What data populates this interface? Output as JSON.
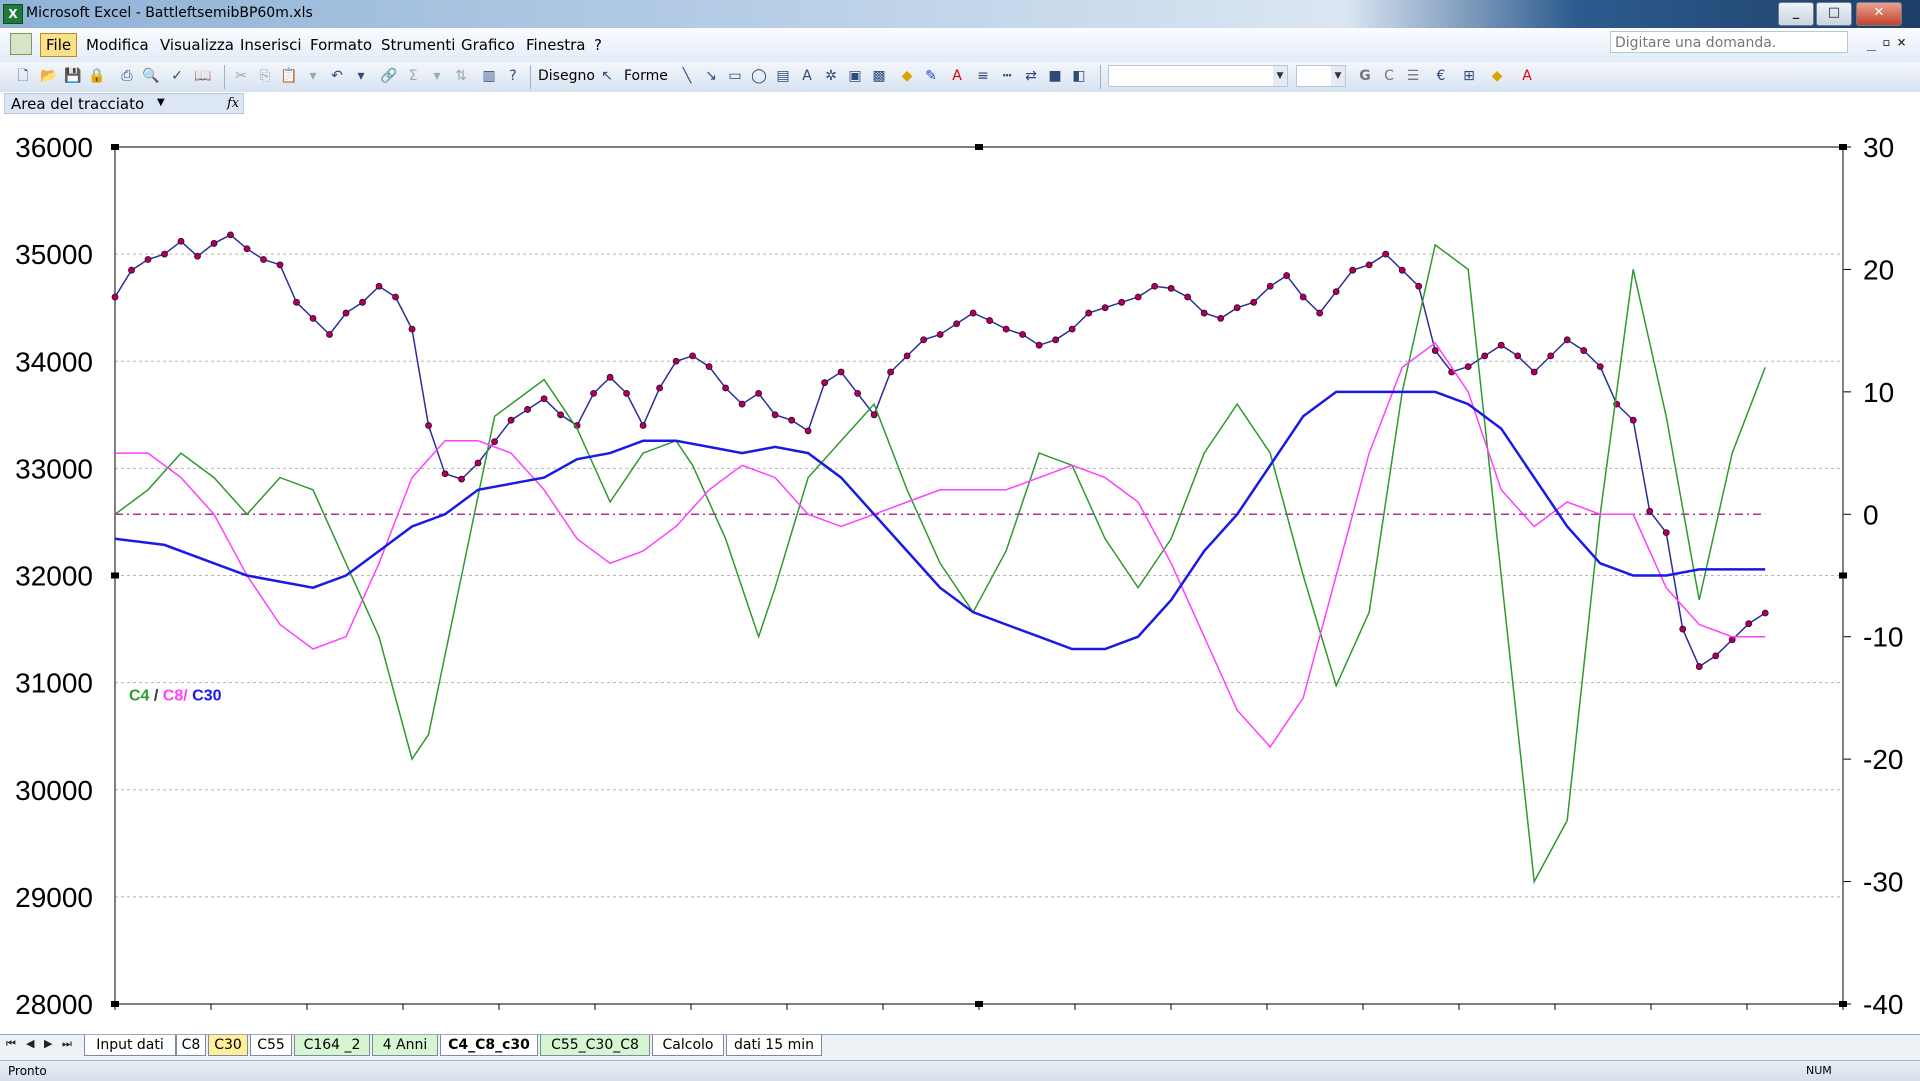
{
  "window": {
    "title": "Microsoft Excel - BattleftsemibBP60m.xls",
    "app_icon": "excel-icon",
    "controls": [
      "_",
      "□",
      "✕"
    ]
  },
  "menu": {
    "items": [
      "File",
      "Modifica",
      "Visualizza",
      "Inserisci",
      "Formato",
      "Strumenti",
      "Grafico",
      "Finestra",
      "?"
    ],
    "help_placeholder": "Digitare una domanda."
  },
  "toolbar": {
    "draw_label": "Disegno",
    "shapes_label": "Forme"
  },
  "namebox": {
    "value": "Area del tracciato",
    "fx": "fx"
  },
  "sheets": {
    "tabs": [
      "Input dati",
      "C8",
      "C30",
      "C55",
      "C164 _2",
      "4 Anni",
      "C4_C8_c30",
      "C55_C30_C8",
      "Calcolo",
      "dati 15 min"
    ],
    "active": "C4_C8_c30"
  },
  "status": {
    "text": "Pronto",
    "num": "NUM"
  },
  "colors": {
    "price": "#2d2d9a",
    "price_marker": "#b0005a",
    "c4": "#2e9a2e",
    "c8": "#ff40ff",
    "c30": "#1a1ae6",
    "zero_line": "#b0308f",
    "grid": "#b5b5b5"
  },
  "chart_data": {
    "type": "line",
    "legend": {
      "c4": "C4",
      "slash1": " / ",
      "c8": "C8/",
      "c30": " C30"
    },
    "y_left": {
      "min": 28000,
      "max": 36000,
      "ticks": [
        "28000",
        "29000",
        "30000",
        "31000",
        "32000",
        "33000",
        "34000",
        "35000",
        "36000"
      ]
    },
    "y_right": {
      "min": -40,
      "max": 30,
      "ticks": [
        "-40",
        "-30",
        "-20",
        "-10",
        "0",
        "10",
        "20",
        "30"
      ]
    },
    "x": {
      "min": 0,
      "max": 100
    },
    "series": [
      {
        "key": "price",
        "axis": "left",
        "markers": true,
        "points": [
          [
            0,
            34600
          ],
          [
            1,
            34850
          ],
          [
            2,
            34950
          ],
          [
            3,
            35000
          ],
          [
            4,
            35120
          ],
          [
            5,
            34980
          ],
          [
            6,
            35100
          ],
          [
            7,
            35180
          ],
          [
            8,
            35050
          ],
          [
            9,
            34950
          ],
          [
            10,
            34900
          ],
          [
            11,
            34550
          ],
          [
            12,
            34400
          ],
          [
            13,
            34250
          ],
          [
            14,
            34450
          ],
          [
            15,
            34550
          ],
          [
            16,
            34700
          ],
          [
            17,
            34600
          ],
          [
            18,
            34300
          ],
          [
            19,
            33400
          ],
          [
            20,
            32950
          ],
          [
            21,
            32900
          ],
          [
            22,
            33050
          ],
          [
            23,
            33250
          ],
          [
            24,
            33450
          ],
          [
            25,
            33550
          ],
          [
            26,
            33650
          ],
          [
            27,
            33500
          ],
          [
            28,
            33400
          ],
          [
            29,
            33700
          ],
          [
            30,
            33850
          ],
          [
            31,
            33700
          ],
          [
            32,
            33400
          ],
          [
            33,
            33750
          ],
          [
            34,
            34000
          ],
          [
            35,
            34050
          ],
          [
            36,
            33950
          ],
          [
            37,
            33750
          ],
          [
            38,
            33600
          ],
          [
            39,
            33700
          ],
          [
            40,
            33500
          ],
          [
            41,
            33450
          ],
          [
            42,
            33350
          ],
          [
            43,
            33800
          ],
          [
            44,
            33900
          ],
          [
            45,
            33700
          ],
          [
            46,
            33500
          ],
          [
            47,
            33900
          ],
          [
            48,
            34050
          ],
          [
            49,
            34200
          ],
          [
            50,
            34250
          ],
          [
            51,
            34350
          ],
          [
            52,
            34450
          ],
          [
            53,
            34380
          ],
          [
            54,
            34300
          ],
          [
            55,
            34250
          ],
          [
            56,
            34150
          ],
          [
            57,
            34200
          ],
          [
            58,
            34300
          ],
          [
            59,
            34450
          ],
          [
            60,
            34500
          ],
          [
            61,
            34550
          ],
          [
            62,
            34600
          ],
          [
            63,
            34700
          ],
          [
            64,
            34680
          ],
          [
            65,
            34600
          ],
          [
            66,
            34450
          ],
          [
            67,
            34400
          ],
          [
            68,
            34500
          ],
          [
            69,
            34550
          ],
          [
            70,
            34700
          ],
          [
            71,
            34800
          ],
          [
            72,
            34600
          ],
          [
            73,
            34450
          ],
          [
            74,
            34650
          ],
          [
            75,
            34850
          ],
          [
            76,
            34900
          ],
          [
            77,
            35000
          ],
          [
            78,
            34850
          ],
          [
            79,
            34700
          ],
          [
            80,
            34100
          ],
          [
            81,
            33900
          ],
          [
            82,
            33950
          ],
          [
            83,
            34050
          ],
          [
            84,
            34150
          ],
          [
            85,
            34050
          ],
          [
            86,
            33900
          ],
          [
            87,
            34050
          ],
          [
            88,
            34200
          ],
          [
            89,
            34100
          ],
          [
            90,
            33950
          ],
          [
            91,
            33600
          ],
          [
            92,
            33450
          ],
          [
            93,
            32600
          ],
          [
            94,
            32400
          ],
          [
            95,
            31500
          ],
          [
            96,
            31150
          ],
          [
            97,
            31250
          ],
          [
            98,
            31400
          ],
          [
            99,
            31550
          ],
          [
            100,
            31650
          ]
        ]
      },
      {
        "key": "c4",
        "axis": "right",
        "markers": false,
        "points": [
          [
            0,
            0
          ],
          [
            2,
            2
          ],
          [
            4,
            5
          ],
          [
            6,
            3
          ],
          [
            8,
            0
          ],
          [
            10,
            3
          ],
          [
            12,
            2
          ],
          [
            14,
            -4
          ],
          [
            16,
            -10
          ],
          [
            18,
            -20
          ],
          [
            19,
            -18
          ],
          [
            21,
            -5
          ],
          [
            23,
            8
          ],
          [
            25,
            10
          ],
          [
            26,
            11
          ],
          [
            28,
            7
          ],
          [
            30,
            1
          ],
          [
            32,
            5
          ],
          [
            34,
            6
          ],
          [
            35,
            4
          ],
          [
            37,
            -2
          ],
          [
            39,
            -10
          ],
          [
            40,
            -6
          ],
          [
            42,
            3
          ],
          [
            44,
            6
          ],
          [
            46,
            9
          ],
          [
            48,
            2
          ],
          [
            50,
            -4
          ],
          [
            52,
            -8
          ],
          [
            54,
            -3
          ],
          [
            56,
            5
          ],
          [
            58,
            4
          ],
          [
            60,
            -2
          ],
          [
            62,
            -6
          ],
          [
            64,
            -2
          ],
          [
            66,
            5
          ],
          [
            68,
            9
          ],
          [
            70,
            5
          ],
          [
            72,
            -5
          ],
          [
            74,
            -14
          ],
          [
            76,
            -8
          ],
          [
            78,
            10
          ],
          [
            80,
            22
          ],
          [
            82,
            20
          ],
          [
            84,
            -5
          ],
          [
            86,
            -30
          ],
          [
            88,
            -25
          ],
          [
            90,
            0
          ],
          [
            92,
            20
          ],
          [
            94,
            8
          ],
          [
            96,
            -7
          ],
          [
            98,
            5
          ],
          [
            100,
            12
          ]
        ]
      },
      {
        "key": "c8",
        "axis": "right",
        "markers": false,
        "points": [
          [
            0,
            5
          ],
          [
            2,
            5
          ],
          [
            4,
            3
          ],
          [
            6,
            0
          ],
          [
            8,
            -5
          ],
          [
            10,
            -9
          ],
          [
            12,
            -11
          ],
          [
            14,
            -10
          ],
          [
            16,
            -4
          ],
          [
            18,
            3
          ],
          [
            20,
            6
          ],
          [
            22,
            6
          ],
          [
            24,
            5
          ],
          [
            26,
            2
          ],
          [
            28,
            -2
          ],
          [
            30,
            -4
          ],
          [
            32,
            -3
          ],
          [
            34,
            -1
          ],
          [
            36,
            2
          ],
          [
            38,
            4
          ],
          [
            40,
            3
          ],
          [
            42,
            0
          ],
          [
            44,
            -1
          ],
          [
            46,
            0
          ],
          [
            48,
            1
          ],
          [
            50,
            2
          ],
          [
            52,
            2
          ],
          [
            54,
            2
          ],
          [
            56,
            3
          ],
          [
            58,
            4
          ],
          [
            60,
            3
          ],
          [
            62,
            1
          ],
          [
            64,
            -4
          ],
          [
            66,
            -10
          ],
          [
            68,
            -16
          ],
          [
            70,
            -19
          ],
          [
            72,
            -15
          ],
          [
            74,
            -5
          ],
          [
            76,
            5
          ],
          [
            78,
            12
          ],
          [
            80,
            14
          ],
          [
            82,
            10
          ],
          [
            84,
            2
          ],
          [
            86,
            -1
          ],
          [
            88,
            1
          ],
          [
            90,
            0
          ],
          [
            92,
            0
          ],
          [
            94,
            -6
          ],
          [
            96,
            -9
          ],
          [
            98,
            -10
          ],
          [
            100,
            -10
          ]
        ]
      },
      {
        "key": "c30",
        "axis": "right",
        "markers": false,
        "points": [
          [
            0,
            -2
          ],
          [
            3,
            -2.5
          ],
          [
            6,
            -4
          ],
          [
            8,
            -5
          ],
          [
            10,
            -5.5
          ],
          [
            12,
            -6
          ],
          [
            14,
            -5
          ],
          [
            16,
            -3
          ],
          [
            18,
            -1
          ],
          [
            20,
            0
          ],
          [
            22,
            2
          ],
          [
            24,
            2.5
          ],
          [
            26,
            3
          ],
          [
            28,
            4.5
          ],
          [
            30,
            5
          ],
          [
            32,
            6
          ],
          [
            34,
            6
          ],
          [
            36,
            5.5
          ],
          [
            38,
            5
          ],
          [
            40,
            5.5
          ],
          [
            42,
            5
          ],
          [
            44,
            3
          ],
          [
            46,
            0
          ],
          [
            48,
            -3
          ],
          [
            50,
            -6
          ],
          [
            52,
            -8
          ],
          [
            54,
            -9
          ],
          [
            56,
            -10
          ],
          [
            58,
            -11
          ],
          [
            60,
            -11
          ],
          [
            62,
            -10
          ],
          [
            64,
            -7
          ],
          [
            66,
            -3
          ],
          [
            68,
            0
          ],
          [
            70,
            4
          ],
          [
            72,
            8
          ],
          [
            74,
            10
          ],
          [
            76,
            10
          ],
          [
            78,
            10
          ],
          [
            80,
            10
          ],
          [
            82,
            9
          ],
          [
            84,
            7
          ],
          [
            86,
            3
          ],
          [
            88,
            -1
          ],
          [
            90,
            -4
          ],
          [
            92,
            -5
          ],
          [
            94,
            -5
          ],
          [
            96,
            -4.5
          ],
          [
            98,
            -4.5
          ],
          [
            100,
            -4.5
          ]
        ]
      }
    ]
  }
}
